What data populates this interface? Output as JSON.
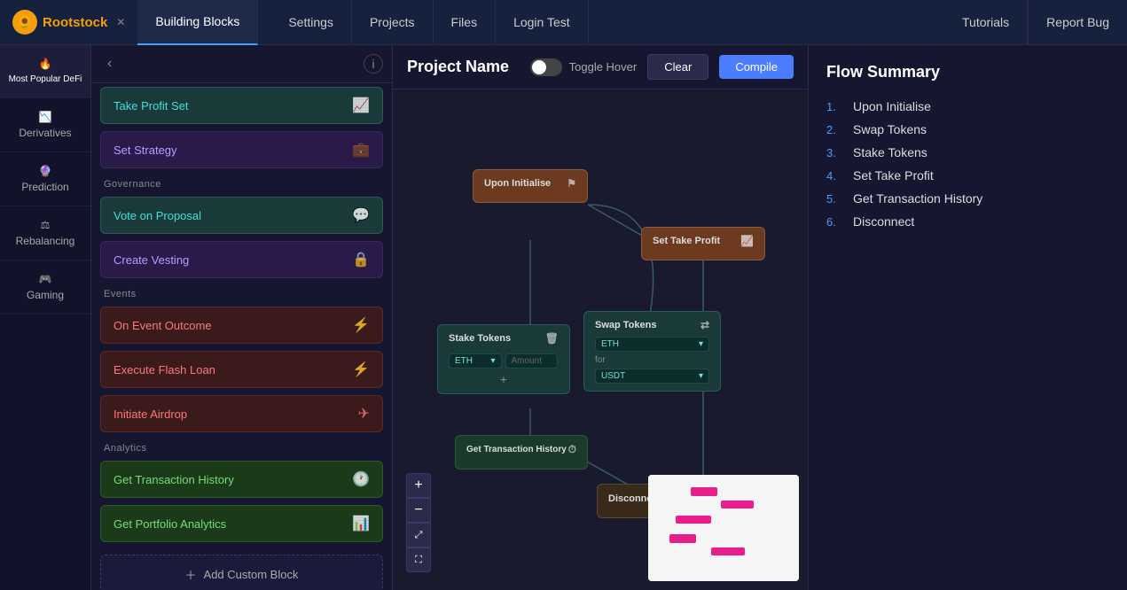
{
  "nav": {
    "logo": "🌻",
    "app_name": "Rootstock",
    "active_project_tab": "Building Blocks",
    "tabs": [
      "Settings",
      "Projects",
      "Files",
      "Login Test",
      "Tutorials",
      "Report Bug"
    ]
  },
  "sidebar": {
    "categories": [
      {
        "label": "Most Popular DeFi",
        "active": true
      },
      {
        "label": "Derivatives"
      },
      {
        "label": "Prediction"
      },
      {
        "label": "Rebalancing"
      },
      {
        "label": "Gaming"
      }
    ]
  },
  "blocks_panel": {
    "sections": [
      {
        "header": "",
        "items": [
          {
            "label": "Take Profit Set",
            "icon": "📈",
            "style": "teal"
          },
          {
            "label": "Set Strategy",
            "icon": "💼",
            "style": "purple"
          }
        ]
      },
      {
        "header": "Governance",
        "items": [
          {
            "label": "Vote on Proposal",
            "icon": "💬",
            "style": "teal"
          },
          {
            "label": "Create Vesting",
            "icon": "🔒",
            "style": "purple"
          }
        ]
      },
      {
        "header": "Events",
        "items": [
          {
            "label": "On Event Outcome",
            "icon": "⚡",
            "style": "red"
          },
          {
            "label": "Execute Flash Loan",
            "icon": "⚡",
            "style": "red"
          },
          {
            "label": "Initiate Airdrop",
            "icon": "✈",
            "style": "red"
          }
        ]
      },
      {
        "header": "Analytics",
        "items": [
          {
            "label": "Get Transaction History",
            "icon": "🕐",
            "style": "green"
          },
          {
            "label": "Get Portfolio Analytics",
            "icon": "📊",
            "style": "green"
          }
        ]
      }
    ],
    "add_custom_label": "Add Custom Block"
  },
  "canvas": {
    "project_name": "Project Name",
    "toggle_label": "Toggle Hover",
    "clear_label": "Clear",
    "compile_label": "Compile"
  },
  "flow_nodes": {
    "initialise": {
      "label": "Upon Initialise",
      "icon": "⚑"
    },
    "take_profit": {
      "label": "Set Take Profit",
      "icon": "📈"
    },
    "stake_tokens": {
      "label": "Stake Tokens",
      "icon": "🗑"
    },
    "swap_tokens": {
      "label": "Swap Tokens",
      "icon": "⇄"
    },
    "swap_from": "ETH",
    "swap_for": "USDT",
    "stake_token": "ETH",
    "get_tx": {
      "label": "Get Transaction History",
      "icon": "⏱"
    },
    "disconnect": {
      "label": "Disconnect",
      "icon": "⏻"
    }
  },
  "flow_summary": {
    "title": "Flow Summary",
    "items": [
      {
        "num": "1.",
        "label": "Upon Initialise"
      },
      {
        "num": "2.",
        "label": "Swap Tokens"
      },
      {
        "num": "3.",
        "label": "Stake Tokens"
      },
      {
        "num": "4.",
        "label": "Set Take Profit"
      },
      {
        "num": "5.",
        "label": "Get Transaction History"
      },
      {
        "num": "6.",
        "label": "Disconnect"
      }
    ]
  },
  "zoom": {
    "plus": "+",
    "minus": "−",
    "fit": "⤢",
    "fullscreen": "⛶"
  }
}
